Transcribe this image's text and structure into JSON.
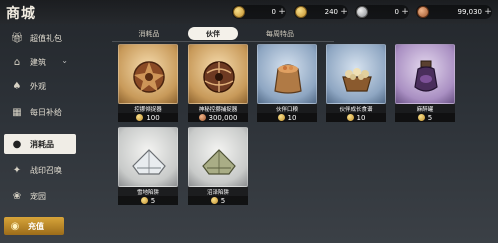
{
  "header": {
    "title": "商城",
    "currencies": [
      {
        "icon": "gold-coin-icon",
        "value": "0"
      },
      {
        "icon": "gold-coin-icon",
        "value": "240"
      },
      {
        "icon": "silver-coin-icon",
        "value": "0"
      },
      {
        "icon": "copper-coin-icon",
        "value": "99,030"
      }
    ],
    "plus_symbol": "+"
  },
  "sidebar": {
    "items": [
      {
        "label": "超值礼包",
        "icon": "gift-icon"
      },
      {
        "label": "建筑",
        "icon": "building-icon",
        "chevron": "⌄"
      },
      {
        "label": "外观",
        "icon": "outfit-icon"
      },
      {
        "label": "每日补给",
        "icon": "calendar-icon"
      },
      {
        "label": "消耗品",
        "icon": "consumable-icon"
      },
      {
        "label": "战印召唤",
        "icon": "summon-icon"
      },
      {
        "label": "宠园",
        "icon": "pet-icon"
      }
    ],
    "active_index": 4,
    "recharge_label": "充值"
  },
  "tabs": {
    "items": [
      "消耗品",
      "伙伴",
      "每周特品"
    ],
    "active_index": 1
  },
  "items": [
    {
      "name": "控挪倾捉器",
      "price": "100",
      "currency": "gold",
      "bg": "gold",
      "art": "net-ball"
    },
    {
      "name": "神秘控挪捕捉器",
      "price": "300,000",
      "currency": "copper",
      "bg": "gold",
      "art": "net-ball-dark"
    },
    {
      "name": "伙伴口粮",
      "price": "10",
      "currency": "gold",
      "bg": "blue",
      "art": "sack"
    },
    {
      "name": "伙伴成长食谱",
      "price": "10",
      "currency": "gold",
      "bg": "blue",
      "art": "basket"
    },
    {
      "name": "麻醉罐",
      "price": "5",
      "currency": "gold",
      "bg": "purple",
      "art": "jar"
    },
    {
      "name": "雪地陷阱",
      "price": "5",
      "currency": "gold",
      "bg": "white",
      "art": "trap-white"
    },
    {
      "name": "沼泽陷阱",
      "price": "5",
      "currency": "gold",
      "bg": "white",
      "art": "trap-green"
    }
  ],
  "colors": {
    "accent_gold": "#d8a53a",
    "active_tab_bg": "#f4f1ea",
    "panel_bg": "#2d3238"
  }
}
